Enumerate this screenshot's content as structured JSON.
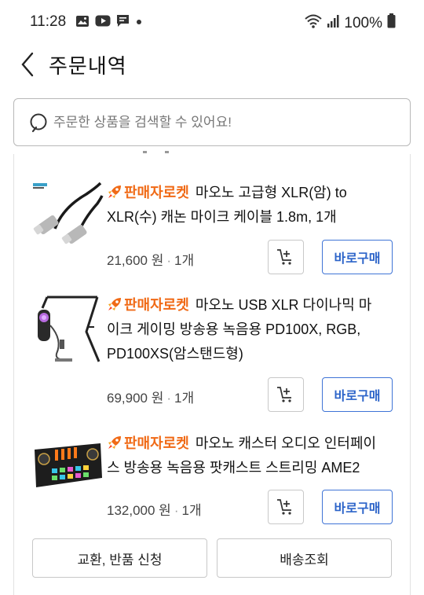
{
  "status_bar": {
    "time": "11:28",
    "battery": "100%",
    "left_icons": [
      "gallery-icon",
      "youtube-icon",
      "message-icon",
      "dot-icon"
    ],
    "right_icons": [
      "wifi-icon",
      "signal-icon",
      "battery-icon"
    ]
  },
  "header": {
    "title": "주문내역"
  },
  "search": {
    "placeholder": "주문한 상품을 검색할 수 있어요!"
  },
  "items": [
    {
      "badge": "판매자로켓",
      "title": "마오노 고급형 XLR(암) to XLR(수) 캐논 마이크 케이블 1.8m, 1개",
      "price": "21,600 원",
      "qty": "1개",
      "buy_label": "바로구매"
    },
    {
      "badge": "판매자로켓",
      "title": "마오노 USB XLR 다이나믹 마이크 게이밍 방송용 녹음용 PD100X, RGB, PD100XS(암스탠드형)",
      "price": "69,900 원",
      "qty": "1개",
      "buy_label": "바로구매"
    },
    {
      "badge": "판매자로켓",
      "title": "마오노 캐스터 오디오 인터페이스 방송용 녹음용 팟캐스트 스트리밍 AME2",
      "price": "132,000 원",
      "qty": "1개",
      "buy_label": "바로구매"
    }
  ],
  "actions": {
    "exchange_label": "교환, 반품 신청",
    "tracking_label": "배송조회"
  },
  "colors": {
    "rocket_orange": "#f06a16",
    "buy_blue": "#2c64c9"
  }
}
